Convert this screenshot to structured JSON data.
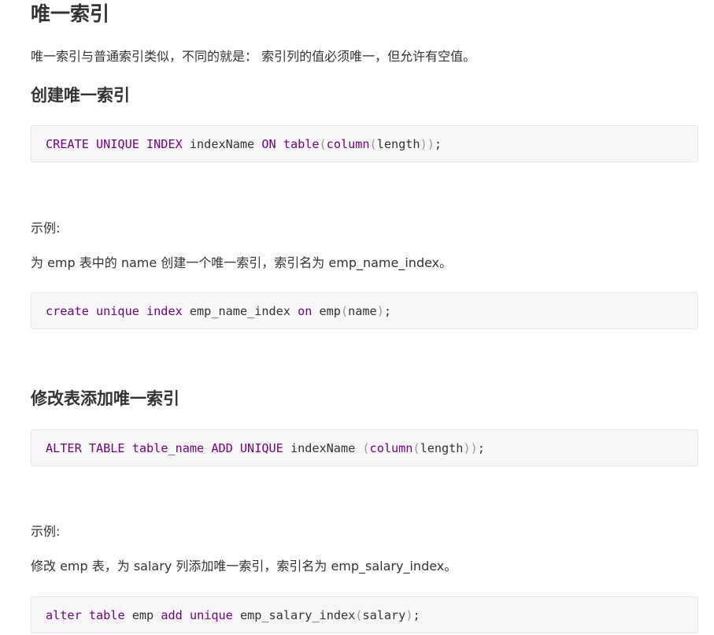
{
  "title": "唯一索引",
  "intro": "唯一索引与普通索引类似，不同的就是： 索引列的值必须唯一，但允许有空值。",
  "sections": [
    {
      "heading": "创建唯一索引",
      "syntax_code": "CREATE UNIQUE INDEX indexName ON table(column(length));",
      "example_label": "示例:",
      "example_desc": "为 emp 表中的 name 创建一个唯一索引，索引名为 emp_name_index。",
      "example_code": "create unique index emp_name_index on emp(name);"
    },
    {
      "heading": "修改表添加唯一索引",
      "syntax_code": "ALTER TABLE table_name ADD UNIQUE indexName (column(length));",
      "example_label": "示例:",
      "example_desc": "修改 emp 表，为 salary 列添加唯一索引，索引名为 emp_salary_index。",
      "example_code": "alter table emp add unique emp_salary_index(salary);"
    }
  ],
  "colors": {
    "keyword": "#770088",
    "text": "#333333",
    "code_background": "#f7f7f7",
    "code_border": "#e6e6e6"
  },
  "tokens": {
    "create_kw": "CREATE UNIQUE INDEX",
    "index_name": "indexName",
    "on_kw": "ON",
    "table_fn": "table",
    "column_fn": "column",
    "length_id": "length",
    "lp": "(",
    "rp": ")",
    "semi": ";",
    "ex1_kw": "create unique index",
    "ex1_name": "emp_name_index",
    "ex1_on": "on",
    "ex1_tbl": "emp",
    "ex1_col": "name",
    "alter_kw": "ALTER TABLE",
    "table_name": "table_name",
    "add_kw": "ADD UNIQUE",
    "index_name2": "indexName",
    "ex2_alter": "alter",
    "ex2_table": "table",
    "ex2_tbl": "emp",
    "ex2_add": "add",
    "ex2_unique": "unique",
    "ex2_name": "emp_salary_index",
    "ex2_col": "salary"
  }
}
